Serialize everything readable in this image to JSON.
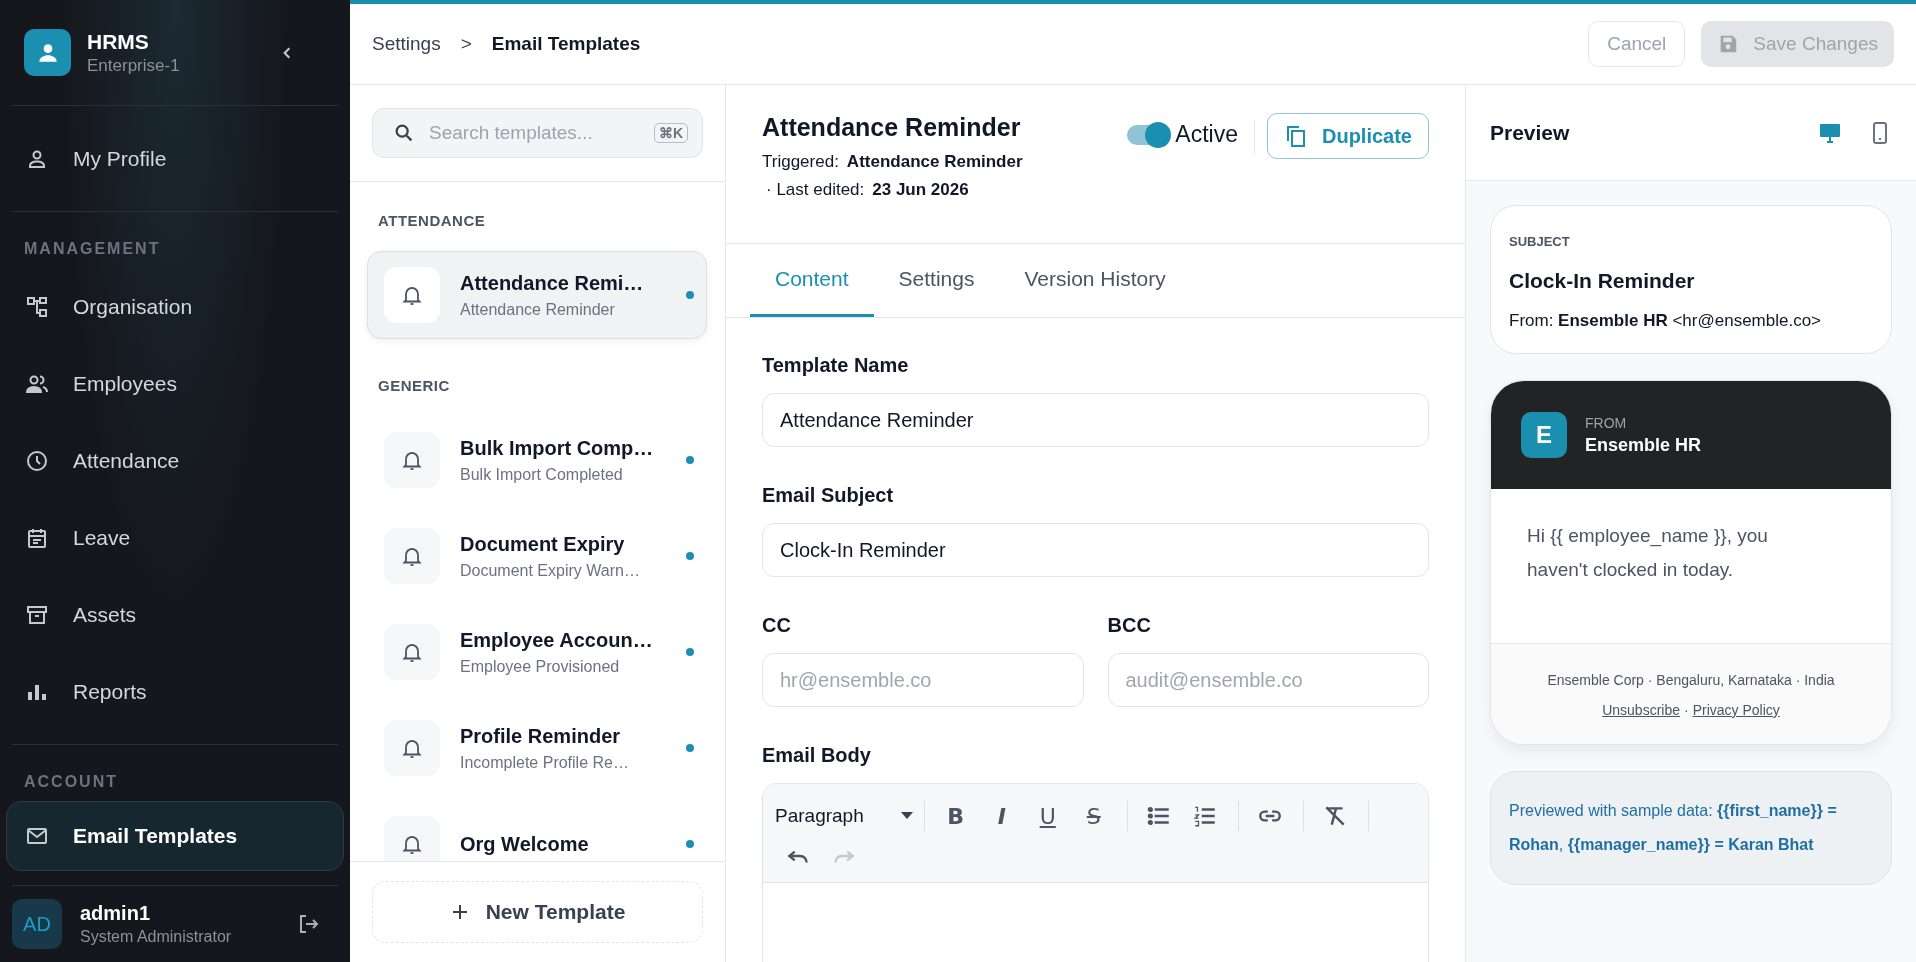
{
  "sidebar": {
    "brand": {
      "name": "HRMS",
      "subtitle": "Enterprise-1"
    },
    "sections": [
      {
        "items": [
          {
            "label": "My Profile",
            "selected": false
          }
        ]
      },
      {
        "label": "MANAGEMENT",
        "items": [
          {
            "label": "Organisation",
            "selected": false
          },
          {
            "label": "Employees",
            "selected": false
          },
          {
            "label": "Attendance",
            "selected": false
          },
          {
            "label": "Leave",
            "selected": false
          },
          {
            "label": "Assets",
            "selected": false
          },
          {
            "label": "Reports",
            "selected": false
          }
        ]
      },
      {
        "label": "ACCOUNT",
        "items": [
          {
            "label": "Email Templates",
            "selected": true
          }
        ]
      }
    ],
    "user": {
      "initials": "AD",
      "name": "admin1",
      "role": "System Administrator"
    }
  },
  "header": {
    "breadcrumb": [
      "Settings",
      "Email Templates"
    ],
    "separator": ">",
    "cancel": "Cancel",
    "save": {
      "label": "Save Changes",
      "disabled": true
    }
  },
  "template_list": {
    "search": {
      "placeholder": "Search templates...",
      "shortcut": "⌘K"
    },
    "groups": [
      {
        "label": "ATTENDANCE",
        "items": [
          {
            "title": "Attendance Remi…",
            "subtitle": "Attendance Reminder",
            "selected": true,
            "active": true
          }
        ]
      },
      {
        "label": "GENERIC",
        "items": [
          {
            "title": "Bulk Import Comp…",
            "subtitle": "Bulk Import Completed",
            "selected": false,
            "active": true
          },
          {
            "title": "Document Expiry",
            "subtitle": "Document Expiry Warn…",
            "selected": false,
            "active": true
          },
          {
            "title": "Employee Accoun…",
            "subtitle": "Employee Provisioned",
            "selected": false,
            "active": true
          },
          {
            "title": "Profile Reminder",
            "subtitle": "Incomplete Profile Re…",
            "selected": false,
            "active": true
          },
          {
            "title": "Org Welcome",
            "selected": false,
            "active": true
          }
        ]
      }
    ],
    "new_button": "New Template"
  },
  "editor": {
    "title": "Attendance Reminder",
    "triggered_label": "Triggered:",
    "triggered_value": "Attendance Reminder",
    "edited_label": "· Last edited:",
    "edited_value": "23 Jun 2026",
    "toggle": {
      "label": "Active",
      "on": true
    },
    "duplicate": "Duplicate",
    "tabs": [
      {
        "label": "Content",
        "selected": true
      },
      {
        "label": "Settings",
        "selected": false
      },
      {
        "label": "Version History",
        "selected": false
      }
    ],
    "template_name": {
      "label": "Template Name",
      "value": "Attendance Reminder"
    },
    "subject": {
      "label": "Email Subject",
      "value": "Clock-In Reminder"
    },
    "cc": {
      "label": "CC",
      "placeholder": "hr@ensemble.co"
    },
    "bcc": {
      "label": "BCC",
      "placeholder": "audit@ensemble.co"
    },
    "body": {
      "label": "Email Body",
      "block_format": "Paragraph",
      "toolbar": [
        {
          "kind": "bold",
          "label": "B",
          "disabled": false
        },
        {
          "kind": "italic",
          "label": "I",
          "disabled": false
        },
        {
          "kind": "underline",
          "label": "U",
          "disabled": false
        },
        {
          "kind": "strike",
          "label": "S",
          "disabled": false
        },
        {
          "kind": "bullets",
          "disabled": false
        },
        {
          "kind": "numbers",
          "disabled": false
        },
        {
          "kind": "link",
          "disabled": false
        },
        {
          "kind": "clear",
          "disabled": false
        },
        {
          "kind": "undo",
          "disabled": false
        },
        {
          "kind": "redo",
          "disabled": true
        }
      ]
    }
  },
  "preview": {
    "title": "Preview",
    "devices": [
      {
        "kind": "desktop",
        "selected": true
      },
      {
        "kind": "mobile",
        "selected": false
      }
    ],
    "subject_card": {
      "label": "SUBJECT",
      "subject": "Clock-In Reminder",
      "from": "From: **Ensemble HR** <hr@ensemble.co>"
    },
    "email": {
      "avatar": "E",
      "from_label": "FROM",
      "sender": "Ensemble HR",
      "body": "Hi {{ employee_name }}, you haven't clocked in today.",
      "address": "Ensemble Corp · Bengaluru, Karnataka · India",
      "links": [
        "Unsubscribe",
        "Privacy Policy"
      ],
      "link_separator": "·"
    },
    "note": "Previewed with sample data: **{{first_name}} = Rohan**, **{{manager_name}} = Karan Bhat**"
  }
}
